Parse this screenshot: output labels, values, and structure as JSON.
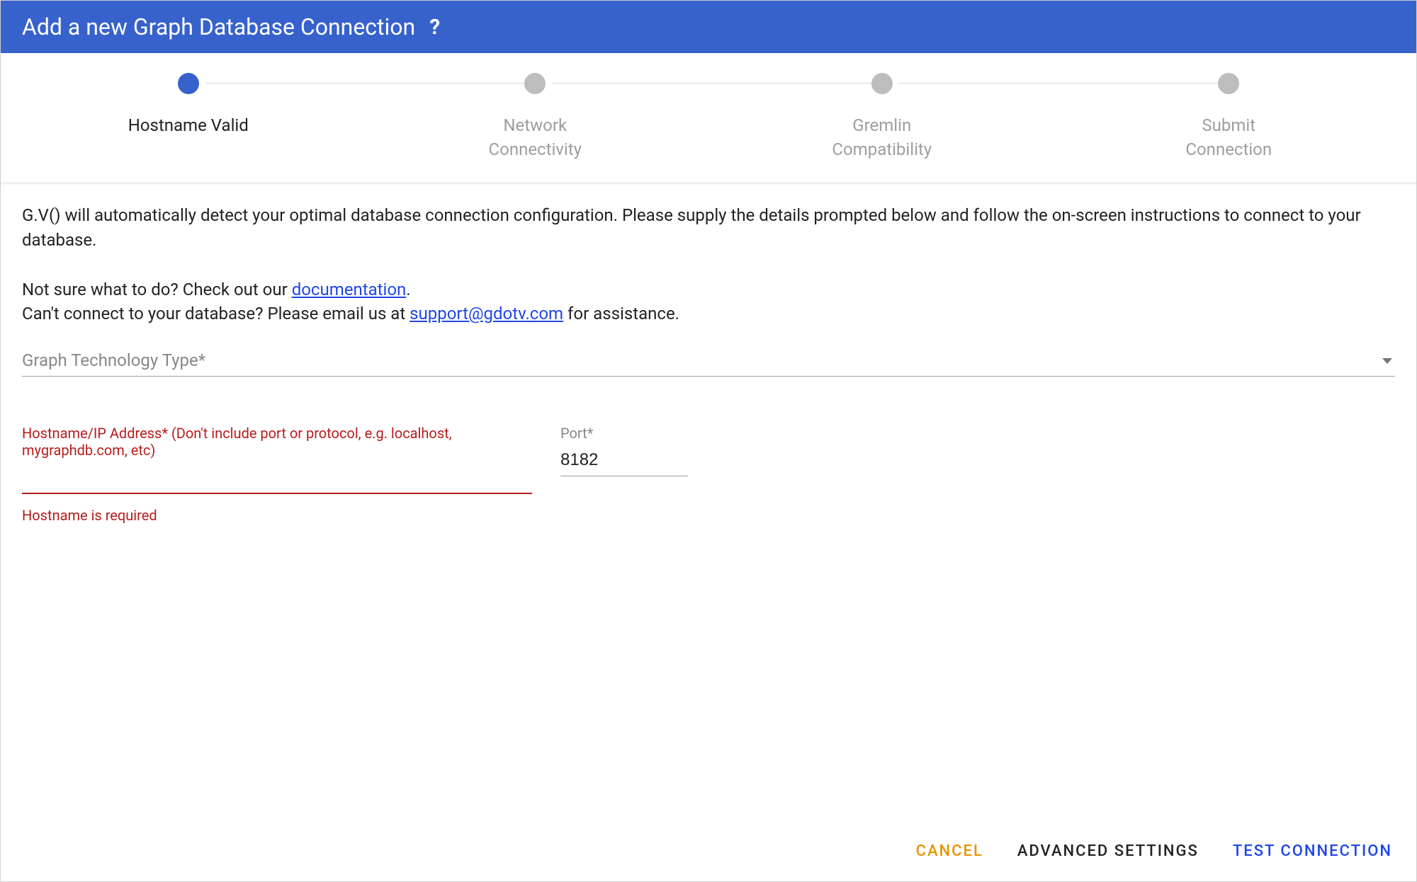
{
  "header": {
    "title": "Add a new Graph Database Connection",
    "help_icon": "?"
  },
  "stepper": {
    "steps": [
      {
        "label": "Hostname Valid",
        "active": true
      },
      {
        "label": "Network\nConnectivity",
        "active": false
      },
      {
        "label": "Gremlin\nCompatibility",
        "active": false
      },
      {
        "label": "Submit\nConnection",
        "active": false
      }
    ]
  },
  "intro": {
    "line1": "G.V() will automatically detect your optimal database connection configuration. Please supply the details prompted below and follow the on-screen instructions to connect to your database.",
    "line2_prefix": "Not sure what to do? Check out our ",
    "doc_link_text": "documentation",
    "line2_suffix": ".",
    "line3_prefix": "Can't connect to your database? Please email us at ",
    "support_email": "support@gdotv.com",
    "line3_suffix": " for assistance."
  },
  "fields": {
    "tech_type": {
      "placeholder": "Graph Technology Type*",
      "value": ""
    },
    "hostname": {
      "label": "Hostname/IP Address* (Don't include port or protocol, e.g. localhost, mygraphdb.com, etc)",
      "value": "",
      "error": "Hostname is required"
    },
    "port": {
      "label": "Port*",
      "value": "8182"
    }
  },
  "footer": {
    "cancel": "CANCEL",
    "advanced": "ADVANCED SETTINGS",
    "test": "TEST CONNECTION"
  }
}
